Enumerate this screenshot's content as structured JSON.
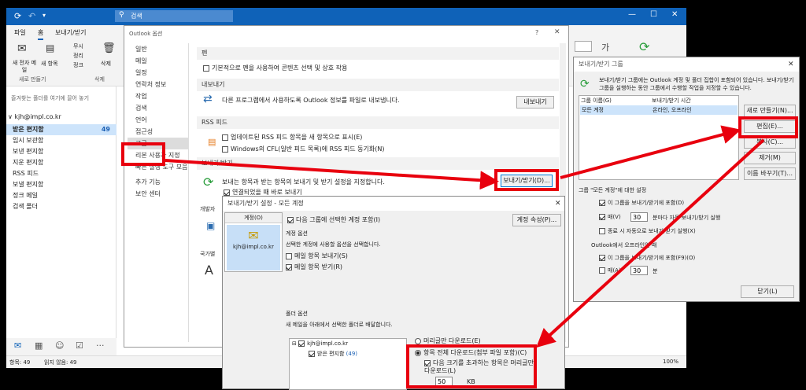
{
  "titlebar": {
    "search": "검색"
  },
  "ribbon": {
    "tabs": [
      "파일",
      "홈",
      "보내기/받기"
    ],
    "new_mail": "새 전자 메일",
    "new_items": "새 항목",
    "ignore": "무시",
    "cleanup": "정리",
    "junk": "정크",
    "delete": "삭제",
    "group_new": "새로 만들기",
    "group_delete": "삭제"
  },
  "search": {
    "placeholder": "즐겨찾는 폴더를 여기에 끌어 놓기"
  },
  "account": "kjh@impl.co.kr",
  "folders": [
    {
      "name": "받은 편지함",
      "count": "49"
    },
    {
      "name": "임시 보관함",
      "count": ""
    },
    {
      "name": "보낸 편지함",
      "count": ""
    },
    {
      "name": "지운 편지함",
      "count": ""
    },
    {
      "name": "RSS 피드",
      "count": ""
    },
    {
      "name": "보낼 편지함",
      "count": ""
    },
    {
      "name": "정크 메일",
      "count": ""
    },
    {
      "name": "검색 폴더",
      "count": ""
    }
  ],
  "statusbar": {
    "items": "항목: 49",
    "unread": "읽지 않음: 49",
    "zoom": "100%"
  },
  "options": {
    "title": "Outlook 옵션",
    "nav": [
      "일반",
      "메일",
      "일정",
      "연락처 정보",
      "작업",
      "검색",
      "언어",
      "접근성",
      "고급",
      "리본 사용자 지정",
      "빠른 실행 도구 모음",
      "추가 기능",
      "보안 센터"
    ],
    "pen_header": "펜",
    "pen_option": "기본적으로 펜을 사용하여 콘텐츠 선택 및 상호 작용",
    "export_header": "내보내기",
    "export_desc": "다른 프로그램에서 사용하도록 Outlook 정보를 파일로 내보냅니다.",
    "export_btn": "내보내기",
    "rss_header": "RSS 피드",
    "rss_opt1": "업데이트된 RSS 피드 항목을 새 항목으로 표시(E)",
    "rss_opt2": "Windows의 CFL(일반 피드 목록)에 RSS 피드 동기화(N)",
    "sr_header": "보내기/받기",
    "sr_desc": "보내는 항목과 받는 항목의 보내기 및 받기 설정을 지정합니다.",
    "sr_btn": "보내기/받기(D)...",
    "sr_opt": "연결되었을 때 바로 보내기",
    "dev_header": "개발자",
    "intl_header": "국가별"
  },
  "sr_settings": {
    "title": "보내기/받기 설정 - 모든 계정",
    "accounts_label": "계정(O)",
    "account_name": "kjh@impl.co.kr",
    "include_label": "다음 그룹에 선택한 계정 포함(I)",
    "account_props_btn": "계정 속성(P)...",
    "account_options": "계정 옵션",
    "account_options_desc": "선택한 계정에 사용할 옵션을 선택합니다.",
    "send_items": "메일 항목 보내기(S)",
    "recv_items": "메일 항목 받기(R)",
    "folder_options": "폴더 옵션",
    "folder_desc": "새 메일을 아래에서 선택한 폴더로 배달합니다.",
    "tree_account": "kjh@impl.co.kr",
    "tree_inbox": "받은 편지함",
    "tree_count": "(49)",
    "dl_headers": "머리글만 다운로드(E)",
    "dl_full": "항목 전체 다운로드(첨부 파일 포함)(C)",
    "dl_limit": "다음 크기를 초과하는 항목은 머리글만 다운로드(L)",
    "dl_size": "50",
    "dl_unit": "KB"
  },
  "sr_groups": {
    "title": "보내기/받기 그룹",
    "desc": "보내기/받기 그룹에는 Outlook 계정 및 폴더 집합이 포함되어 있습니다. 보내기/받기 그룹을 실행하는 동안 그룹에서 수행할 작업을 지정할 수 있습니다.",
    "col_name": "그룹 이름(G)",
    "col_time": "보내기/받기 시간",
    "row_name": "모든 계정",
    "row_time": "온라인, 오프라인",
    "new_btn": "새로 만들기(N)...",
    "edit_btn": "편집(E)...",
    "copy_btn": "복사(C)...",
    "remove_btn": "제거(M)",
    "rename_btn": "이름 바꾸기(T)...",
    "settings_title": "그룹 \"모든 계정\"에 대한 설정",
    "online_include": "이 그룹을 보내기/받기에 포함(D)",
    "every": "매(V)",
    "minutes_val": "30",
    "minutes_label": "분마다 자동 보내기/받기 실행",
    "on_exit": "종료 시 자동으로 보내기/받기 실행(X)",
    "offline_title": "Outlook에서 오프라인일 때",
    "offline_include": "이 그룹을 보내기/받기에 포함(F9)(O)",
    "offline_every": "매(A)",
    "offline_val": "30",
    "offline_unit": "분",
    "close_btn": "닫기(L)"
  }
}
